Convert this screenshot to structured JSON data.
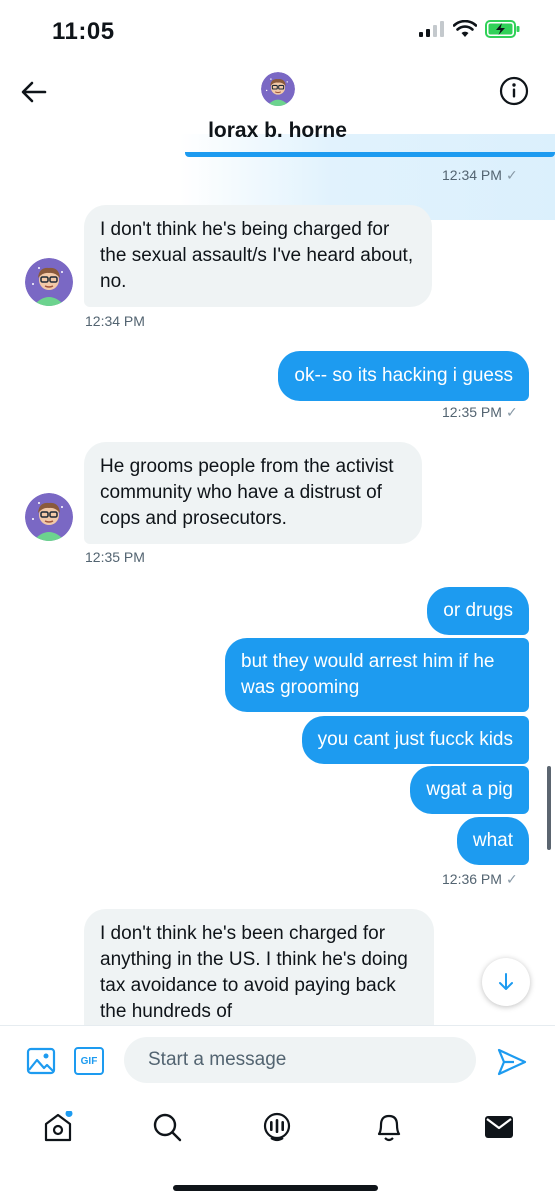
{
  "status_bar": {
    "time": "11:05"
  },
  "header": {
    "name": "lorax b. horne"
  },
  "messages": [
    {
      "timestamp": "12:34 PM"
    },
    {
      "text": "I don't think he's being charged for the sexual assault/s I've heard about, no.",
      "timestamp": "12:34 PM"
    },
    {
      "text": "ok-- so its hacking i guess",
      "timestamp": "12:35 PM"
    },
    {
      "text": "He grooms people from the activist community who have a distrust of cops and prosecutors.",
      "timestamp": "12:35 PM"
    },
    {
      "text": "or drugs"
    },
    {
      "text": "but they would arrest him if he was grooming"
    },
    {
      "text": "you cant just fucck kids"
    },
    {
      "text": "wgat a pig"
    },
    {
      "text": "what",
      "timestamp": "12:36 PM"
    },
    {
      "text": "I don't think he's been charged for anything in the US. I think he's doing tax avoidance to avoid paying back the hundreds of"
    }
  ],
  "composer": {
    "placeholder": "Start a message",
    "gif_label": "GIF"
  },
  "nav": {
    "items": [
      "home-icon",
      "search-icon",
      "spaces-icon",
      "notifications-icon",
      "messages-icon"
    ]
  },
  "colors": {
    "accent": "#1d9bf0",
    "incoming_bubble": "#eff3f4",
    "muted_text": "#536471"
  }
}
